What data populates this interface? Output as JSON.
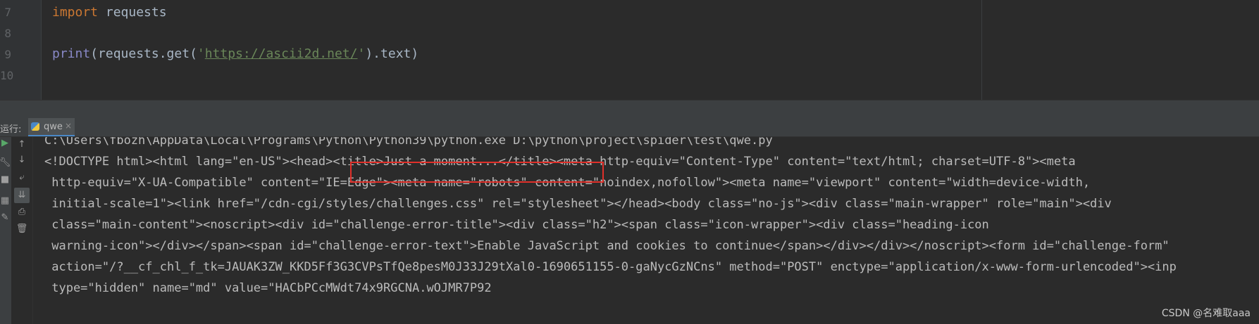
{
  "editor": {
    "line_numbers": [
      "7",
      "8",
      "9",
      "10"
    ],
    "lines": {
      "l7": {
        "kw": "import",
        "rest": " requests"
      },
      "l9": {
        "fn": "print",
        "pre": "(requests.get(",
        "q1": "'",
        "url": "https://ascii2d.net/",
        "q2": "'",
        "post": ").text)"
      }
    }
  },
  "run_panel": {
    "label": "运行:",
    "tab_name": "qwe",
    "tab_close": "×"
  },
  "toolbar": {
    "icons": [
      "run-icon",
      "scroll-up-icon",
      "wrench-icon",
      "scroll-down-icon",
      "stop-icon",
      "soft-wrap-icon",
      "layout-icon",
      "scroll-to-end-icon",
      "pin-icon",
      "print-icon",
      "trash-icon"
    ]
  },
  "console": {
    "lines": [
      "C:\\Users\\fbozh\\AppData\\Local\\Programs\\Python\\Python39\\python.exe D:\\python\\project\\spider\\test\\qwe.py",
      "<!DOCTYPE html><html lang=\"en-US\"><head><title>Just a moment...</title><meta http-equiv=\"Content-Type\" content=\"text/html; charset=UTF-8\"><meta",
      " http-equiv=\"X-UA-Compatible\" content=\"IE=Edge\"><meta name=\"robots\" content=\"noindex,nofollow\"><meta name=\"viewport\" content=\"width=device-width,",
      " initial-scale=1\"><link href=\"/cdn-cgi/styles/challenges.css\" rel=\"stylesheet\"></head><body class=\"no-js\"><div class=\"main-wrapper\" role=\"main\"><div",
      " class=\"main-content\"><noscript><div id=\"challenge-error-title\"><div class=\"h2\"><span class=\"icon-wrapper\"><div class=\"heading-icon",
      " warning-icon\"></div></span><span id=\"challenge-error-text\">Enable JavaScript and cookies to continue</span></div></div></noscript><form id=\"challenge-form\"",
      " action=\"/?__cf_chl_f_tk=JAUAK3ZW_KKD5Ff3G3CVPsTfQe8pesM0J33J29tXal0-1690651155-0-gaNycGzNCns\" method=\"POST\" enctype=\"application/x-www-form-urlencoded\"><inp",
      " type=\"hidden\" name=\"md\" value=\"HACbPCcMWdt74x9RGCNA.wOJMR7P92"
    ]
  },
  "watermark": "CSDN @名难取aaa"
}
